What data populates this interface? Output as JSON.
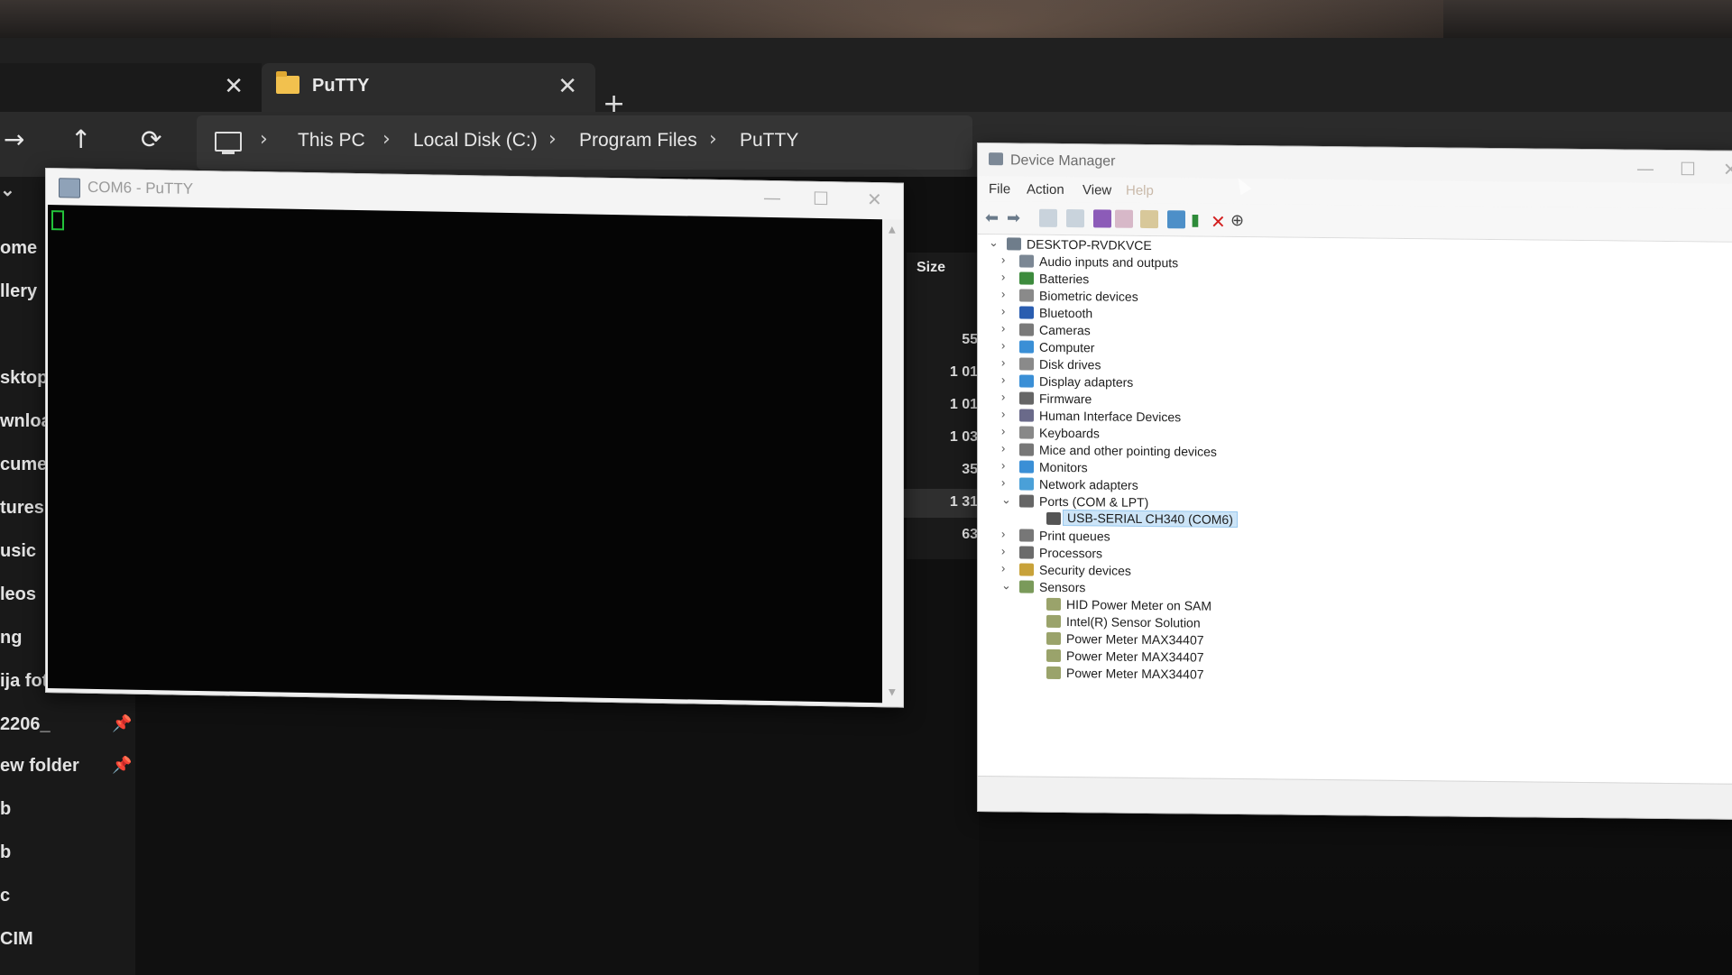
{
  "explorer": {
    "tabs": [
      {
        "label": ""
      },
      {
        "label": "PuTTY"
      }
    ],
    "new_tab": "+",
    "nav": {
      "forward": "→",
      "up": "↑",
      "refresh": "⟳"
    },
    "breadcrumb": [
      "This PC",
      "Local Disk (C:)",
      "Program Files",
      "PuTTY"
    ],
    "sidebar_items": [
      {
        "label": "ome"
      },
      {
        "label": "llery"
      },
      {
        "label": "sktop"
      },
      {
        "label": "wnloa"
      },
      {
        "label": "cume"
      },
      {
        "label": "tures"
      },
      {
        "label": "usic"
      },
      {
        "label": "leos"
      },
      {
        "label": "ng"
      },
      {
        "label": "ija fot"
      },
      {
        "label": "2206_"
      },
      {
        "label": "ew folder"
      },
      {
        "label": "b"
      },
      {
        "label": "b"
      },
      {
        "label": "c"
      },
      {
        "label": "CIM"
      }
    ],
    "size_header": "Size",
    "sizes": [
      "55",
      "1 01",
      "1 01",
      "1 03",
      "35",
      "1 31",
      "63"
    ]
  },
  "putty": {
    "title": "COM6 - PuTTY"
  },
  "devmgr": {
    "title": "Device Manager",
    "menu": [
      "File",
      "Action",
      "View",
      "Help"
    ],
    "root": "DESKTOP-RVDKVCE",
    "categories": [
      {
        "label": "Audio inputs and outputs",
        "expanded": false
      },
      {
        "label": "Batteries",
        "expanded": false
      },
      {
        "label": "Biometric devices",
        "expanded": false
      },
      {
        "label": "Bluetooth",
        "expanded": false
      },
      {
        "label": "Cameras",
        "expanded": false
      },
      {
        "label": "Computer",
        "expanded": false
      },
      {
        "label": "Disk drives",
        "expanded": false
      },
      {
        "label": "Display adapters",
        "expanded": false
      },
      {
        "label": "Firmware",
        "expanded": false
      },
      {
        "label": "Human Interface Devices",
        "expanded": false
      },
      {
        "label": "Keyboards",
        "expanded": false
      },
      {
        "label": "Mice and other pointing devices",
        "expanded": false
      },
      {
        "label": "Monitors",
        "expanded": false
      },
      {
        "label": "Network adapters",
        "expanded": false
      },
      {
        "label": "Ports (COM & LPT)",
        "expanded": true
      },
      {
        "label": "USB-SERIAL CH340 (COM6)",
        "child": true,
        "selected": true
      },
      {
        "label": "Print queues",
        "expanded": false
      },
      {
        "label": "Processors",
        "expanded": false
      },
      {
        "label": "Security devices",
        "expanded": false
      },
      {
        "label": "Sensors",
        "expanded": true
      },
      {
        "label": "HID Power Meter on SAM",
        "child": true
      },
      {
        "label": "Intel(R) Sensor Solution",
        "child": true
      },
      {
        "label": "Power Meter MAX34407",
        "child": true
      },
      {
        "label": "Power Meter MAX34407",
        "child": true
      },
      {
        "label": "Power Meter MAX34407",
        "child": true
      }
    ],
    "colors": {
      "selection": "#cce4f7",
      "uninstall": "#d32020",
      "enable": "#2e8b3a"
    }
  }
}
